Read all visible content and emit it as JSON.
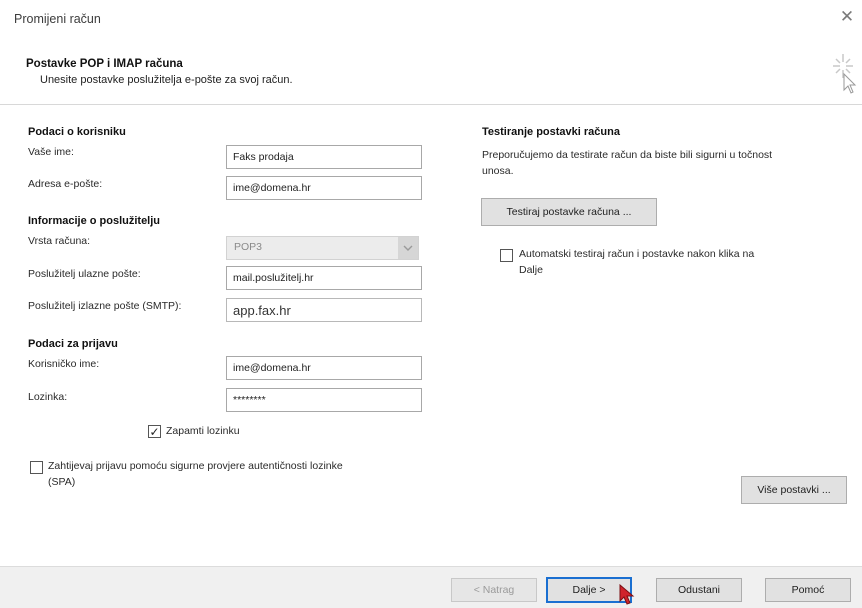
{
  "window": {
    "title": "Promijeni račun",
    "close_glyph": "✕"
  },
  "header": {
    "title": "Postavke POP i IMAP računa",
    "subtitle": "Unesite postavke poslužitelja e-pošte za svoj račun."
  },
  "user_info": {
    "section": "Podaci o korisniku",
    "name_label": "Vaše ime:",
    "name_value": "Faks prodaja",
    "email_label": "Adresa e-pošte:",
    "email_value": "ime@domena.hr"
  },
  "server_info": {
    "section": "Informacije o poslužitelju",
    "account_type_label": "Vrsta računa:",
    "account_type_value": "POP3",
    "incoming_label": "Poslužitelj ulazne pošte:",
    "incoming_value": "mail.poslužitelj.hr",
    "outgoing_label": "Poslužitelj izlazne pošte (SMTP):",
    "outgoing_value": "app.fax.hr"
  },
  "login_info": {
    "section": "Podaci za prijavu",
    "username_label": "Korisničko ime:",
    "username_value": "ime@domena.hr",
    "password_label": "Lozinka:",
    "password_value": "********",
    "remember_label": "Zapamti lozinku",
    "remember_checked": true,
    "spa_label_line1": "Zahtijevaj prijavu pomoću sigurne provjere autentičnosti lozinke",
    "spa_label_line2": "(SPA)",
    "spa_checked": false
  },
  "test_settings": {
    "section": "Testiranje postavki računa",
    "description_line1": "Preporučujemo da testirate račun da biste bili sigurni u točnost",
    "description_line2": "unosa.",
    "test_button": "Testiraj postavke računa ...",
    "auto_test_line1": "Automatski testiraj račun i postavke nakon klika na",
    "auto_test_line2": "Dalje",
    "auto_test_checked": false
  },
  "more_settings_button": "Više postavki ...",
  "footer": {
    "back": "< Natrag",
    "next": "Dalje >",
    "cancel": "Odustani",
    "help": "Pomoć"
  },
  "colors": {
    "default_button_border": "#1a6fd1",
    "cursor": "#d0242b"
  },
  "icons": {
    "sparkle": "sparkle-icon",
    "dropdown": "chevron-down-icon",
    "checkmark": "check-icon"
  }
}
